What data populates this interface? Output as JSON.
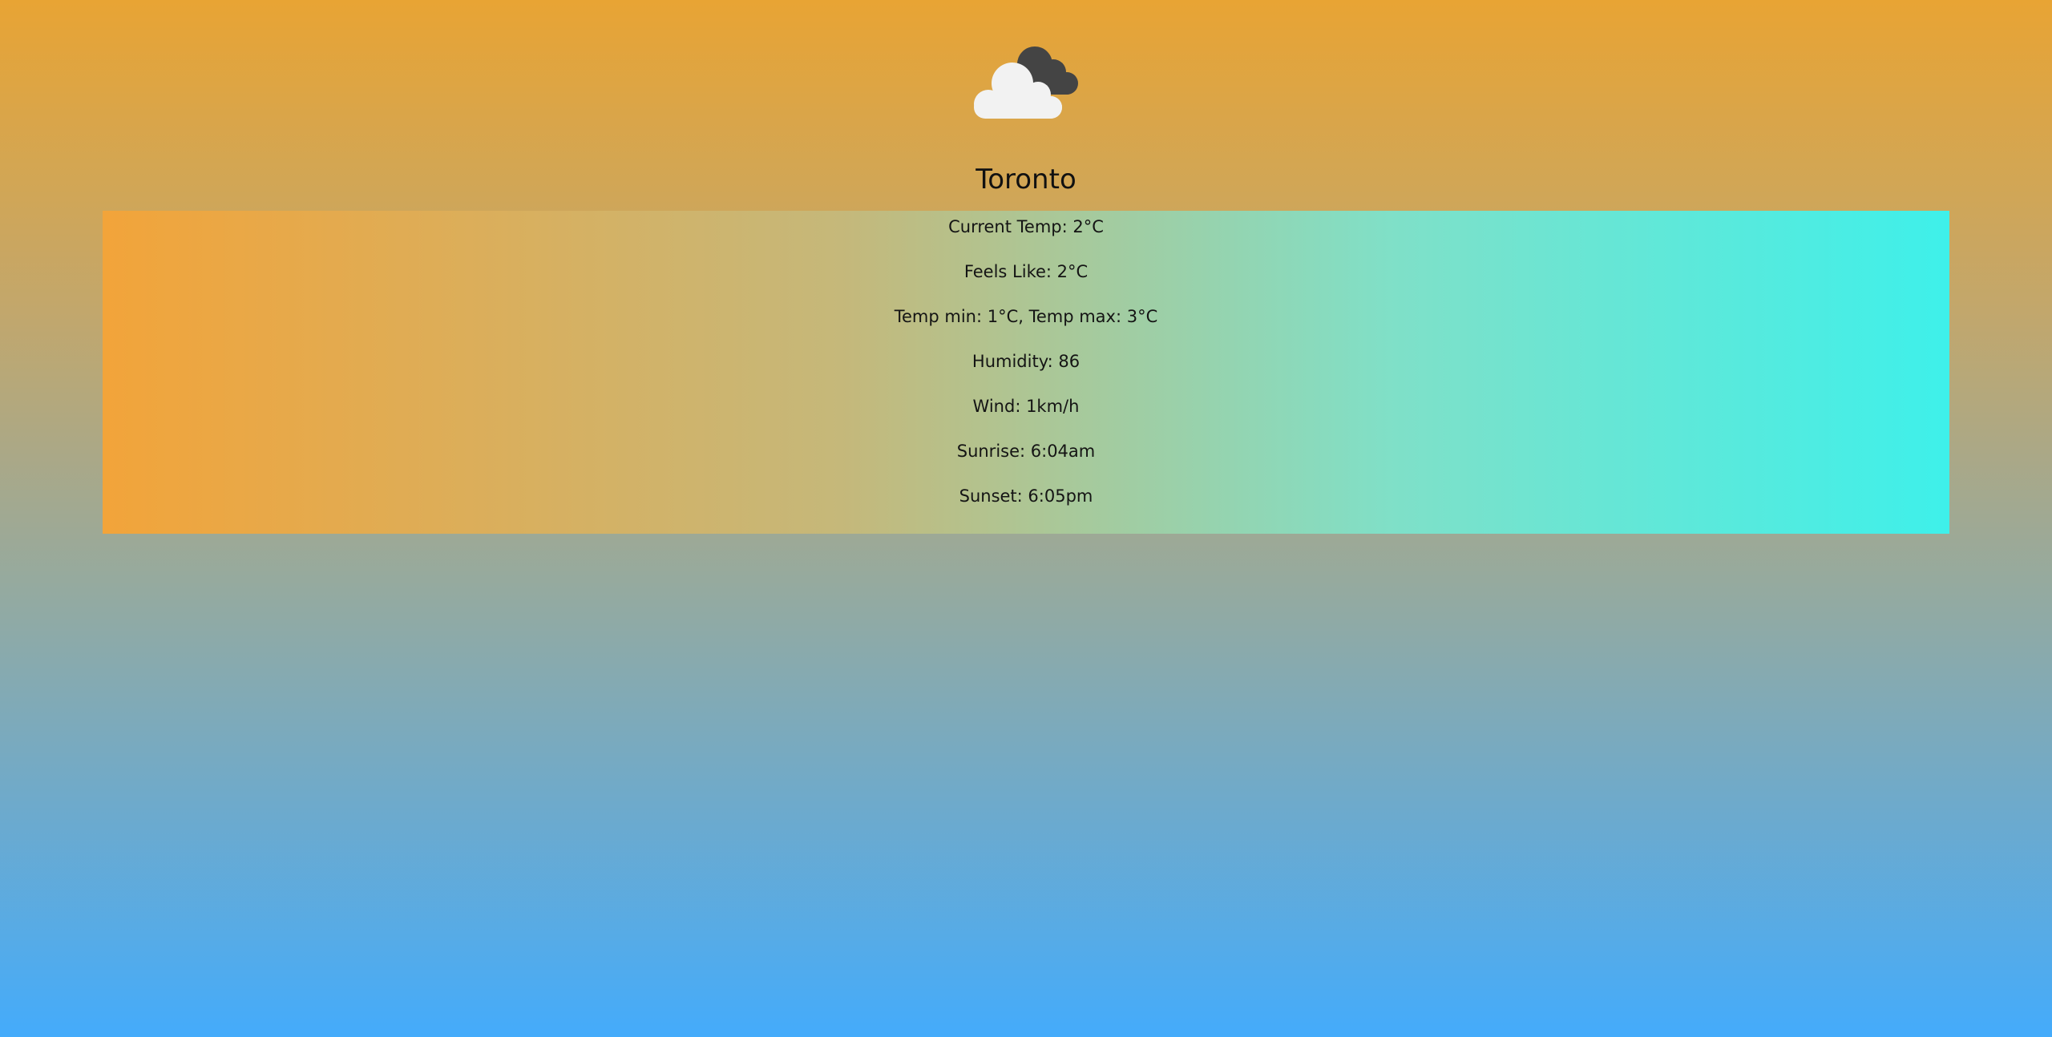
{
  "weather": {
    "icon": "cloudy-icon",
    "city": "Toronto",
    "details": [
      "Current Temp: 2°C",
      "Feels Like: 2°C",
      "Temp min: 1°C, Temp max: 3°C",
      "Humidity: 86",
      "Wind: 1km/h",
      "Sunrise: 6:04am",
      "Sunset: 6:05pm"
    ]
  },
  "colors": {
    "background_top": "#e8a434",
    "background_bottom": "#44abfb",
    "border_left": "#f2a43a",
    "border_right": "#3ef0ea",
    "cloud_front": "#f2f2f2",
    "cloud_back": "#444444"
  }
}
